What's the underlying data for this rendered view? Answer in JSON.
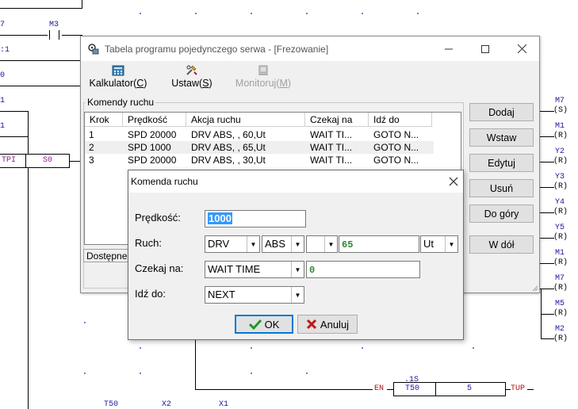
{
  "ladder": {
    "contact_m3": "M3",
    "left_labels": [
      "7",
      ":1",
      "0",
      "1",
      "1"
    ],
    "tpi_label": "TPI",
    "s0_label": "S0",
    "bottom_labels": [
      "T50",
      "X2",
      "X1"
    ],
    "timer": {
      "en": "EN",
      "name": "T50",
      "base": ".1S",
      "value": "5",
      "tup": "TUP"
    },
    "coils": [
      {
        "name": "M7",
        "type": "(S)"
      },
      {
        "name": "M1",
        "type": "(R)"
      },
      {
        "name": "Y2",
        "type": "(R)"
      },
      {
        "name": "Y3",
        "type": "(R)"
      },
      {
        "name": "Y4",
        "type": "(R)"
      },
      {
        "name": "Y5",
        "type": "(R)"
      },
      {
        "name": "M1",
        "type": "(R)"
      },
      {
        "name": "M7",
        "type": "(R)"
      },
      {
        "name": "M5",
        "type": "(R)"
      },
      {
        "name": "M2",
        "type": "(R)"
      }
    ],
    "colors": {
      "wire": "#000000",
      "label": "#1a1aa0",
      "grid_dot": "#7a7adf",
      "tpi": "#8a1a8a"
    }
  },
  "window": {
    "title": "Tabela programu pojedynczego serwa - [Frezowanie]",
    "toolbar": [
      {
        "label_pre": "Kalkulator(",
        "key": "C",
        "label_post": ")",
        "icon": "calculator-icon",
        "enabled": true
      },
      {
        "label_pre": "Ustaw(",
        "key": "S",
        "label_post": ")",
        "icon": "tools-icon",
        "enabled": true
      },
      {
        "label_pre": "Monitoruj(",
        "key": "M",
        "label_post": ")",
        "icon": "monitor-icon",
        "enabled": false
      }
    ],
    "group_title": "Komendy ruchu",
    "columns": [
      "Krok",
      "Prędkość",
      "Akcja ruchu",
      "Czekaj na",
      "Idź do"
    ],
    "rows": [
      [
        "1",
        "SPD 20000",
        "DRV  ABS, , 60,Ut",
        "WAIT TI...",
        "GOTO N..."
      ],
      [
        "2",
        "SPD 1000",
        "DRV  ABS, , 65,Ut",
        "WAIT TI...",
        "GOTO N..."
      ],
      [
        "3",
        "SPD 20000",
        "DRV  ABS, , 30,Ut",
        "WAIT TI...",
        "GOTO N..."
      ]
    ],
    "status": "Dostępne:",
    "buttons": [
      "Dodaj",
      "Wstaw",
      "Edytuj",
      "Usuń",
      "Do góry",
      "W dół"
    ]
  },
  "dialog": {
    "title": "Komenda ruchu",
    "speed_label": "Prędkość:",
    "speed_value": "1000",
    "motion_label": "Ruch:",
    "motion_cmd": "DRV",
    "motion_mode": "ABS",
    "motion_axis": "",
    "motion_value": "65",
    "motion_unit": "Ut",
    "wait_label": "Czekaj na:",
    "wait_value": "WAIT TIME",
    "wait_time": "0",
    "goto_label": "Idź do:",
    "goto_value": "NEXT",
    "ok_label": "OK",
    "cancel_label": "Anuluj"
  }
}
